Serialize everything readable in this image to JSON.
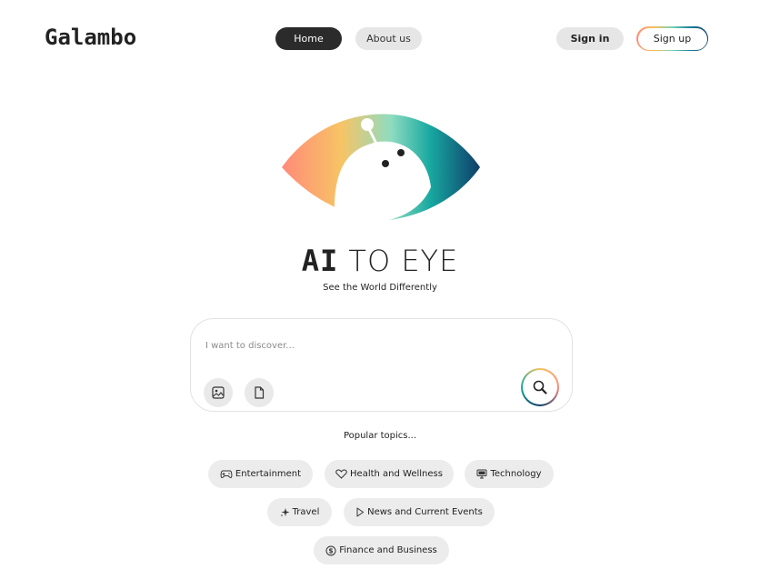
{
  "header": {
    "logo": "Galambo",
    "nav": [
      {
        "label": "Home",
        "active": true
      },
      {
        "label": "About us",
        "active": false
      }
    ],
    "signin_label": "Sign in",
    "signup_label": "Sign up"
  },
  "hero": {
    "title_ai": "AI",
    "title_rest": "TO EYE",
    "subtitle": "See the World Differently"
  },
  "search": {
    "placeholder": "I want to discover...",
    "value": "",
    "attach_icons": [
      "image-icon",
      "file-icon"
    ],
    "submit_icon": "search-icon"
  },
  "topics": {
    "label": "Popular topics...",
    "items": [
      {
        "label": "Entertainment",
        "icon": "gamepad-icon"
      },
      {
        "label": "Health and Wellness",
        "icon": "heart-icon"
      },
      {
        "label": "Technology",
        "icon": "technology-icon"
      },
      {
        "label": "Travel",
        "icon": "sparkle-icon"
      },
      {
        "label": "News and Current Events",
        "icon": "play-icon"
      },
      {
        "label": "Finance and Business",
        "icon": "dollar-icon"
      }
    ]
  },
  "colors": {
    "accent_dark": "#2b2b2b",
    "pill_bg": "#e6e6e6",
    "gradient": [
      "#ff8a7a",
      "#f6c25a",
      "#77d3b8",
      "#17a8a0",
      "#0f3d6a"
    ]
  }
}
